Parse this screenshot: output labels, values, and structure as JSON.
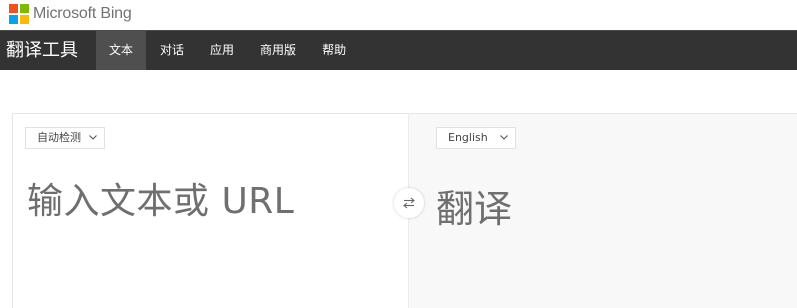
{
  "brand": {
    "name": "Microsoft Bing",
    "logo_colors": [
      "#f25022",
      "#7fba00",
      "#00a4ef",
      "#ffb900"
    ]
  },
  "navbar": {
    "title": "翻译工具",
    "tabs": [
      {
        "label": "文本",
        "active": true
      },
      {
        "label": "对话",
        "active": false
      },
      {
        "label": "应用",
        "active": false
      },
      {
        "label": "商用版",
        "active": false
      },
      {
        "label": "帮助",
        "active": false
      }
    ]
  },
  "translator": {
    "source_language": "自动检测",
    "target_language": "English",
    "source_placeholder": "输入文本或 URL",
    "target_placeholder": "翻译",
    "icons": {
      "dropdown": "chevron-down-icon",
      "swap": "swap-arrows-icon"
    }
  },
  "colors": {
    "navbar_bg": "#333333",
    "active_tab_bg": "#4f4f4f",
    "target_pane_bg": "#f8f8f8"
  }
}
